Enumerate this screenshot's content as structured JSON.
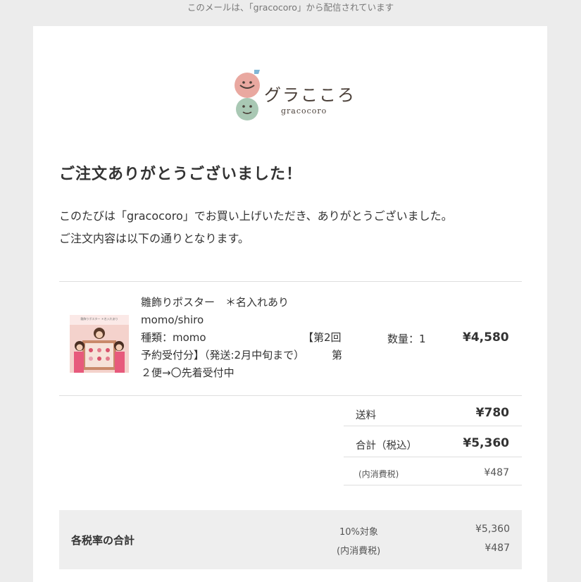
{
  "preheader": "このメールは、「gracocoro」から配信されています",
  "logo": {
    "jp": "グラこころ",
    "en": "gracocoro"
  },
  "heading": "ご注文ありがとうございました！",
  "intro": {
    "line1": "このたびは「gracocoro」でお買い上げいただき、ありがとうございました。",
    "line2": "ご注文内容は以下の通りとなります。"
  },
  "item": {
    "thumb_caption": "雛飾りポスター ＊名入れあり",
    "name_line1": "雛飾りポスター　＊名入れあり",
    "name_line2": "momo/shiro",
    "type_label": "種類：momo",
    "type_option": "【第2回",
    "line4": "予約受付分】（発送:2月中旬まで）",
    "line4_tail": "第",
    "line5": "２便→〇先着受付中",
    "qty": "数量：1",
    "price": "¥4,580"
  },
  "summary": {
    "shipping_label": "送料",
    "shipping_value": "¥780",
    "total_label": "合計（税込）",
    "total_value": "¥5,360",
    "tax_label": "(内消費税)",
    "tax_value": "¥487"
  },
  "tax_breakdown": {
    "title": "各税率の合計",
    "rate_label": "10%対象",
    "rate_value": "¥5,360",
    "tax_label": "(内消費税)",
    "tax_value": "¥487"
  },
  "colors": {
    "background": "#ececec",
    "card": "#ffffff",
    "tax_box": "#eeeeee",
    "logo_pink": "#e9a8a0",
    "logo_green": "#a9c8b4",
    "logo_blue": "#7fb6d6"
  }
}
